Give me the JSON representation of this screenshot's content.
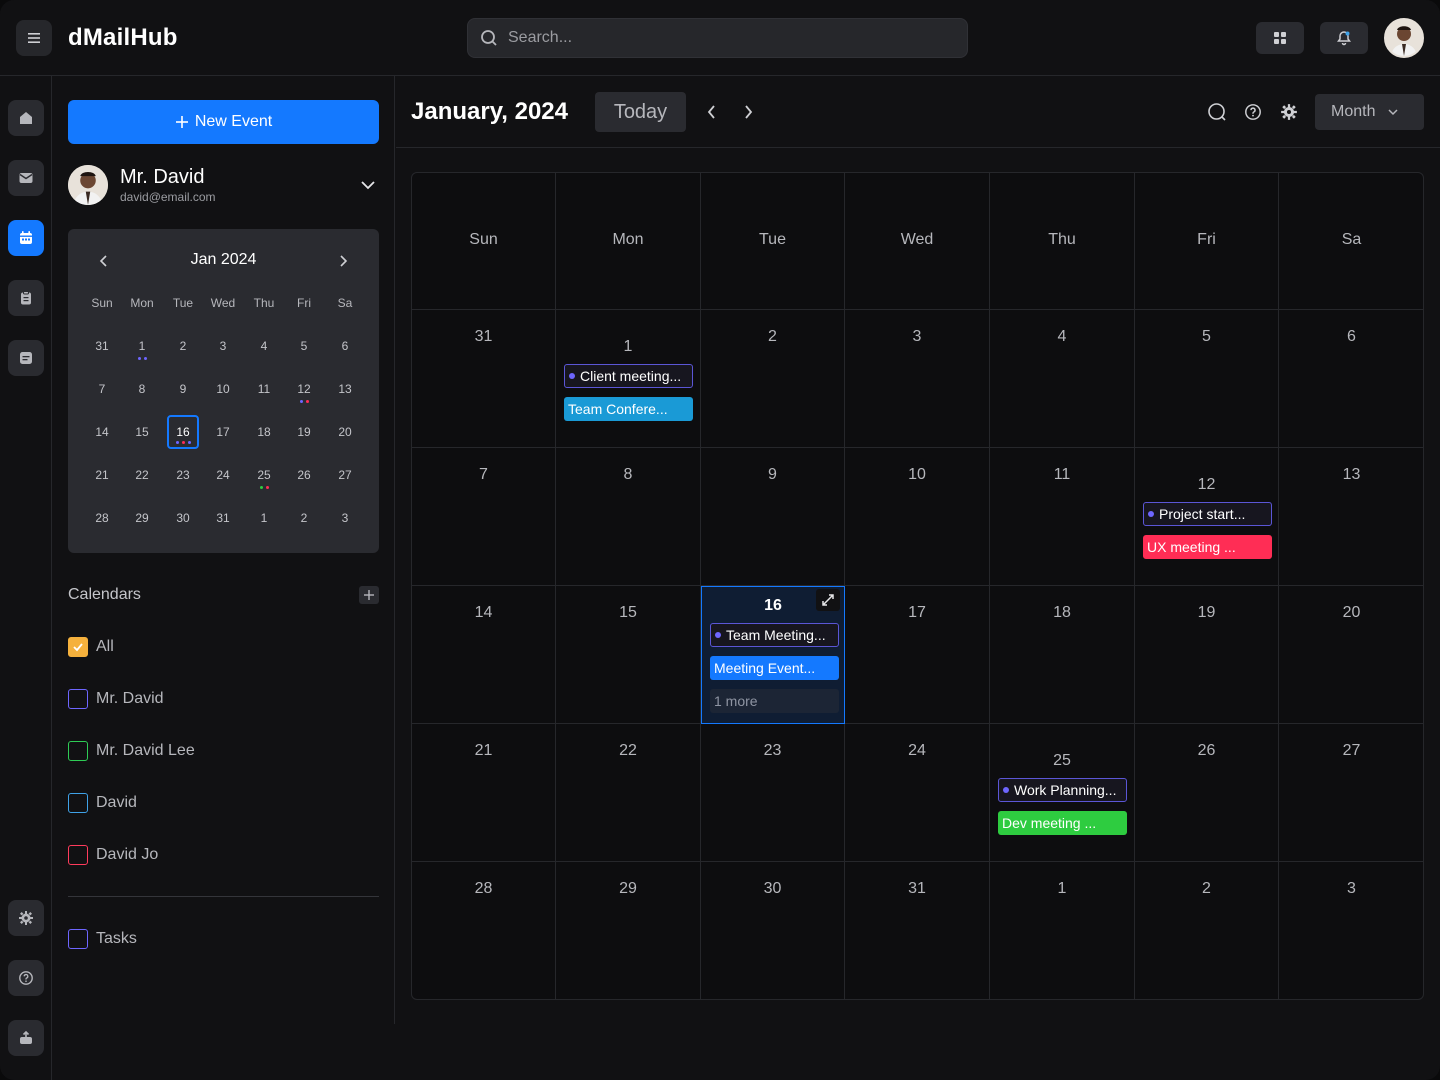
{
  "app": {
    "brand": "dMailHub"
  },
  "search": {
    "placeholder": "Search..."
  },
  "sidebar": {
    "new_event_label": "New Event",
    "user": {
      "name": "Mr. David",
      "email": "david@email.com"
    },
    "mini_calendar": {
      "title": "Jan 2024",
      "weekdays": [
        "Sun",
        "Mon",
        "Tue",
        "Wed",
        "Thu",
        "Fri",
        "Sa"
      ],
      "weeks": [
        [
          "31",
          "1",
          "2",
          "3",
          "4",
          "5",
          "6"
        ],
        [
          "7",
          "8",
          "9",
          "10",
          "11",
          "12",
          "13"
        ],
        [
          "14",
          "15",
          "16",
          "17",
          "18",
          "19",
          "20"
        ],
        [
          "21",
          "22",
          "23",
          "24",
          "25",
          "26",
          "27"
        ],
        [
          "28",
          "29",
          "30",
          "31",
          "1",
          "2",
          "3"
        ]
      ],
      "selected_day": "16"
    },
    "calendars_title": "Calendars",
    "calendars": [
      {
        "label": "All",
        "checked": true,
        "color": "#f5b13d"
      },
      {
        "label": "Mr. David",
        "checked": false,
        "color": "#6e66ff"
      },
      {
        "label": "Mr. David Lee",
        "checked": false,
        "color": "#2ecc55"
      },
      {
        "label": "David",
        "checked": false,
        "color": "#3fa2e8"
      },
      {
        "label": "David Jo",
        "checked": false,
        "color": "#ff3b5c"
      }
    ],
    "tasks_label": "Tasks"
  },
  "header": {
    "title": "January, 2024",
    "today_label": "Today",
    "view_label": "Month"
  },
  "month_grid": {
    "weekdays": [
      "Sun",
      "Mon",
      "Tue",
      "Wed",
      "Thu",
      "Fri",
      "Sa"
    ],
    "weeks": [
      [
        "31",
        "1",
        "2",
        "3",
        "4",
        "5",
        "6"
      ],
      [
        "7",
        "8",
        "9",
        "10",
        "11",
        "12",
        "13"
      ],
      [
        "14",
        "15",
        "16",
        "17",
        "18",
        "19",
        "20"
      ],
      [
        "21",
        "22",
        "23",
        "24",
        "25",
        "26",
        "27"
      ],
      [
        "28",
        "29",
        "30",
        "31",
        "1",
        "2",
        "3"
      ]
    ],
    "events": [
      {
        "text": "Client meeting...",
        "style": "outline"
      },
      {
        "text": "Team Confere...",
        "style": "solid",
        "color": "#1a9ad6"
      },
      {
        "text": "Project start...",
        "style": "outline"
      },
      {
        "text": "UX meeting ...",
        "style": "solid",
        "color": "#ff2d55"
      },
      {
        "text": "Team Meeting...",
        "style": "outline"
      },
      {
        "text": "Meeting Event...",
        "style": "solid",
        "color": "#1479ff"
      },
      {
        "text": "Work Planning...",
        "style": "outline"
      },
      {
        "text": "Dev meeting ...",
        "style": "solid",
        "color": "#2ecc40"
      }
    ],
    "more_label": "1 more"
  },
  "colors": {
    "accent": "#1479ff",
    "purple": "#6e66ff",
    "red": "#ff2d55",
    "green": "#2ecc40",
    "cyan": "#1a9ad6"
  }
}
